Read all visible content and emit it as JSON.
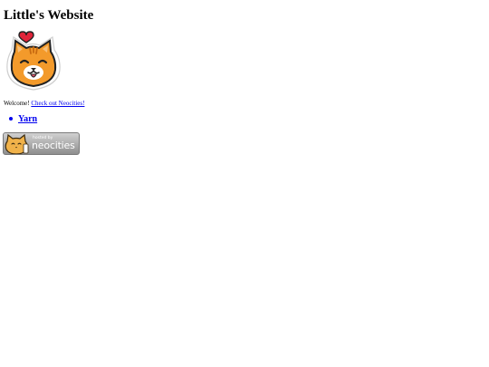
{
  "header": {
    "title": "Little's Website"
  },
  "avatar": {
    "icon": "orange-cat-with-heart-sticker"
  },
  "welcome": {
    "text": "Welcome! ",
    "link_label": "Check out Neocities!"
  },
  "links": [
    {
      "label": "Yarn"
    }
  ],
  "badge": {
    "icon": "neocities-cat-icon",
    "small_text": "hosted by",
    "big_text": "neocities"
  }
}
